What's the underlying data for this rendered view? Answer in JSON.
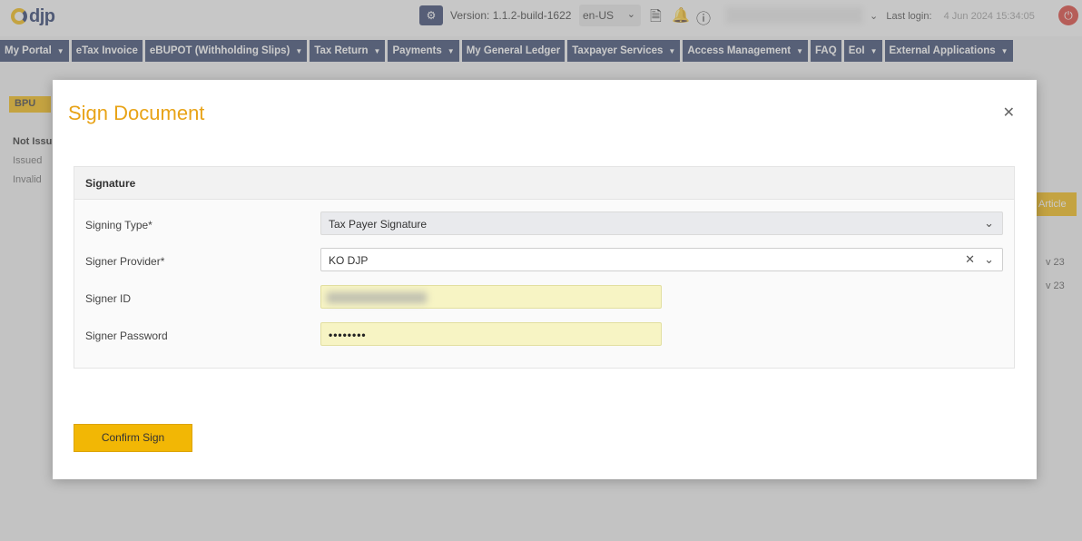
{
  "header": {
    "logo_text": "djp",
    "version_label": "Version:",
    "version_value": "1.1.2-build-1622",
    "language": "en-US",
    "last_login_label": "Last login:",
    "last_login_value": "4 Jun 2024 15:34:05"
  },
  "nav": [
    {
      "label": "My Portal",
      "dropdown": true
    },
    {
      "label": "eTax Invoice",
      "dropdown": false
    },
    {
      "label": "eBUPOT (Withholding Slips)",
      "dropdown": true
    },
    {
      "label": "Tax Return",
      "dropdown": true
    },
    {
      "label": "Payments",
      "dropdown": true
    },
    {
      "label": "My General Ledger",
      "dropdown": false
    },
    {
      "label": "Taxpayer Services",
      "dropdown": true
    },
    {
      "label": "Access Management",
      "dropdown": true
    },
    {
      "label": "FAQ",
      "dropdown": false
    },
    {
      "label": "EoI",
      "dropdown": true
    },
    {
      "label": "External Applications",
      "dropdown": true
    }
  ],
  "background": {
    "badge": "BPU",
    "status_title": "Not Issu",
    "status_1": "Issued",
    "status_2": "Invalid",
    "article_btn": "Article",
    "date_1": "v 23",
    "date_2": "v 23"
  },
  "modal": {
    "title": "Sign Document",
    "section_title": "Signature",
    "signing_type_label": "Signing Type*",
    "signing_type_value": "Tax Payer Signature",
    "signer_provider_label": "Signer Provider*",
    "signer_provider_value": "KO DJP",
    "signer_id_label": "Signer ID",
    "signer_password_label": "Signer Password",
    "signer_password_value": "••••••••",
    "confirm_label": "Confirm Sign"
  }
}
